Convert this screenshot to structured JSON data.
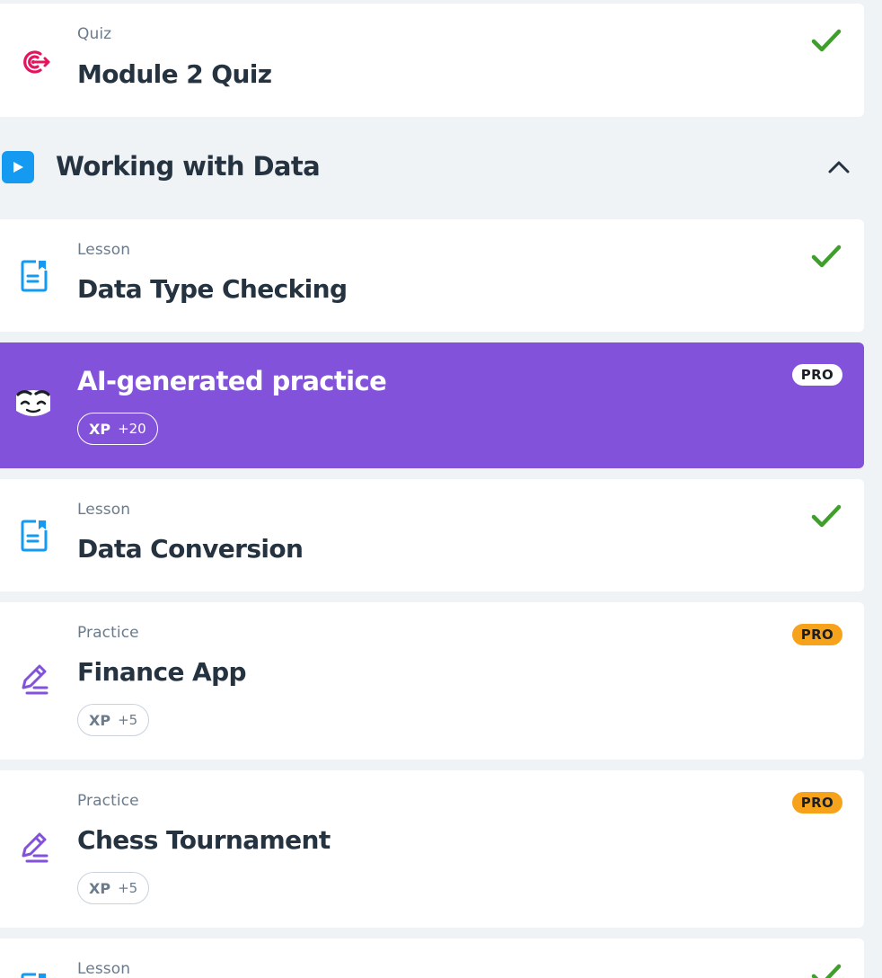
{
  "colors": {
    "check": "#3ea02b",
    "ai_bg": "#8352da",
    "pro_orange": "#f7a21b",
    "lesson_icon": "#149af0",
    "practice_icon": "#8352da",
    "quiz_icon": "#e6135f"
  },
  "items": [
    {
      "kind": "Quiz",
      "title": "Module 2 Quiz",
      "icon": "target-icon",
      "completed": true
    },
    {
      "kind": "Lesson",
      "title": "Data Type Checking",
      "icon": "lesson-document-icon",
      "completed": true
    },
    {
      "kind": "Lesson",
      "title": "Data Conversion",
      "icon": "lesson-document-icon",
      "completed": true
    },
    {
      "kind": "Practice",
      "title": "Finance App",
      "icon": "pencil-icon",
      "badge": "PRO",
      "xp_label": "XP",
      "xp_value": "+5"
    },
    {
      "kind": "Practice",
      "title": "Chess Tournament",
      "icon": "pencil-icon",
      "badge": "PRO",
      "xp_label": "XP",
      "xp_value": "+5"
    },
    {
      "kind": "Lesson",
      "title": "",
      "icon": "lesson-document-icon",
      "completed": true
    }
  ],
  "section": {
    "title": "Working with Data",
    "icon": "play-icon",
    "expanded": true
  },
  "ai_practice": {
    "title": "AI-generated practice",
    "badge": "PRO",
    "xp_label": "XP",
    "xp_value": "+20",
    "icon": "ai-mascot-icon"
  }
}
